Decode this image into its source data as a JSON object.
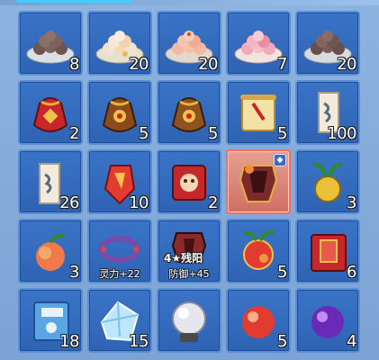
{
  "inventory": {
    "slots": [
      {
        "name": "dumplings-brown",
        "qty": "8"
      },
      {
        "name": "dumplings-cream",
        "qty": "20"
      },
      {
        "name": "dumplings-red",
        "qty": "20"
      },
      {
        "name": "dumplings-pink",
        "qty": "7"
      },
      {
        "name": "dumplings-dark",
        "qty": "20"
      },
      {
        "name": "lucky-bag-red",
        "qty": "2"
      },
      {
        "name": "lucky-bag-brown",
        "qty": "5"
      },
      {
        "name": "lucky-bag-brown-2",
        "qty": "5"
      },
      {
        "name": "scroll-brush",
        "qty": "5"
      },
      {
        "name": "scroll-sigil",
        "qty": "100"
      },
      {
        "name": "scroll-sigil-2",
        "qty": "26"
      },
      {
        "name": "red-talisman",
        "qty": "10"
      },
      {
        "name": "red-mask-scroll",
        "qty": "2"
      },
      {
        "name": "armor-chest",
        "qty": ""
      },
      {
        "name": "golden-radish",
        "qty": "3"
      },
      {
        "name": "peach",
        "qty": "3"
      },
      {
        "name": "spirit-bracelet",
        "qty": "",
        "stat": "灵力+22"
      },
      {
        "name": "defense-armor",
        "qty": "",
        "stat": "防御+45",
        "tag": "4★残阳"
      },
      {
        "name": "spirit-fruit",
        "qty": "5"
      },
      {
        "name": "red-book",
        "qty": "6"
      },
      {
        "name": "blue-book",
        "qty": "18"
      },
      {
        "name": "crystal-ore",
        "qty": "15"
      },
      {
        "name": "crystal-orb",
        "qty": ""
      },
      {
        "name": "red-orb",
        "qty": "5"
      },
      {
        "name": "purple-orb",
        "qty": "4"
      }
    ],
    "selected_index": 13
  }
}
